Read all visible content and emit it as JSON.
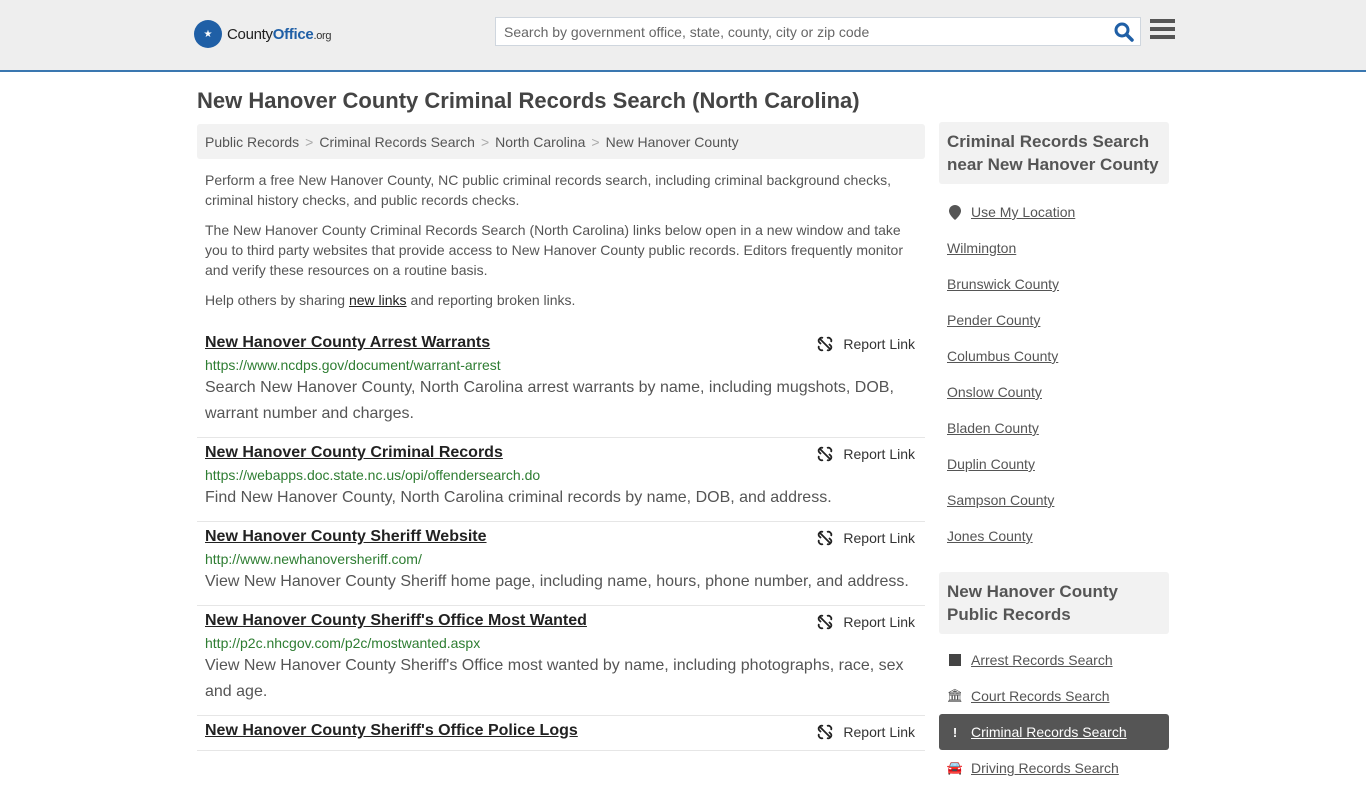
{
  "header": {
    "logo": {
      "county": "County",
      "office": "Office",
      "tld": ".org"
    },
    "search_placeholder": "Search by government office, state, county, city or zip code",
    "search_value": ""
  },
  "page_title": "New Hanover County Criminal Records Search (North Carolina)",
  "breadcrumb": [
    "Public Records",
    "Criminal Records Search",
    "North Carolina",
    "New Hanover County"
  ],
  "intro": {
    "p1": "Perform a free New Hanover County, NC public criminal records search, including criminal background checks, criminal history checks, and public records checks.",
    "p2": "The New Hanover County Criminal Records Search (North Carolina) links below open in a new window and take you to third party websites that provide access to New Hanover County public records. Editors frequently monitor and verify these resources on a routine basis.",
    "p3_before": "Help others by sharing ",
    "p3_link": "new links",
    "p3_after": " and reporting broken links."
  },
  "report_label": "Report Link",
  "results": [
    {
      "title": "New Hanover County Arrest Warrants",
      "url": "https://www.ncdps.gov/document/warrant-arrest",
      "desc": "Search New Hanover County, North Carolina arrest warrants by name, including mugshots, DOB, warrant number and charges."
    },
    {
      "title": "New Hanover County Criminal Records",
      "url": "https://webapps.doc.state.nc.us/opi/offendersearch.do",
      "desc": "Find New Hanover County, North Carolina criminal records by name, DOB, and address."
    },
    {
      "title": "New Hanover County Sheriff Website",
      "url": "http://www.newhanoversheriff.com/",
      "desc": "View New Hanover County Sheriff home page, including name, hours, phone number, and address."
    },
    {
      "title": "New Hanover County Sheriff's Office Most Wanted",
      "url": "http://p2c.nhcgov.com/p2c/mostwanted.aspx",
      "desc": "View New Hanover County Sheriff's Office most wanted by name, including photographs, race, sex and age."
    },
    {
      "title": "New Hanover County Sheriff's Office Police Logs",
      "url": "",
      "desc": ""
    }
  ],
  "sidebar": {
    "nearby_title": "Criminal Records Search near New Hanover County",
    "use_location": "Use My Location",
    "nearby": [
      "Wilmington",
      "Brunswick County",
      "Pender County",
      "Columbus County",
      "Onslow County",
      "Bladen County",
      "Duplin County",
      "Sampson County",
      "Jones County"
    ],
    "public_title": "New Hanover County Public Records",
    "public_items": [
      {
        "label": "Arrest Records Search",
        "icon": "square-icon",
        "active": false
      },
      {
        "label": "Court Records Search",
        "icon": "courthouse-icon",
        "active": false
      },
      {
        "label": "Criminal Records Search",
        "icon": "exclamation-icon",
        "active": true
      },
      {
        "label": "Driving Records Search",
        "icon": "car-icon",
        "active": false
      }
    ]
  },
  "colors": {
    "brand_blue": "#1f5fa6",
    "url_green": "#2e7d32",
    "active_bg": "#555555"
  }
}
